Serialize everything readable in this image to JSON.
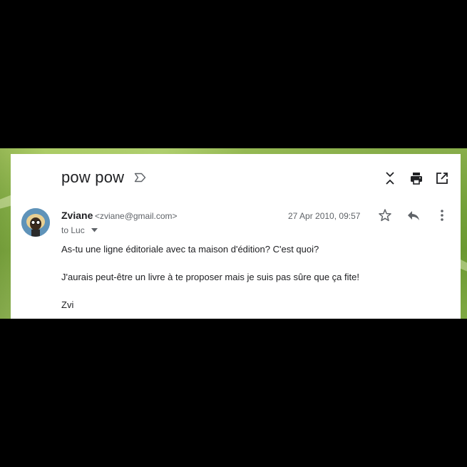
{
  "email": {
    "subject": "pow pow",
    "sender": {
      "name": "Zviane",
      "email": "<zviane@gmail.com>"
    },
    "date": "27 Apr 2010, 09:57",
    "recipient_line": "to Luc",
    "body_lines": [
      "As-tu une ligne éditoriale avec ta maison d'édition? C'est quoi?",
      "J'aurais peut-être un livre à te proposer mais je suis pas sûre que ça fite!",
      "Zvi"
    ]
  },
  "icons": {
    "label": "label-icon",
    "collapse": "collapse-all-icon",
    "print": "print-icon",
    "open_new": "open-in-new-window-icon",
    "star": "star-icon",
    "reply": "reply-icon",
    "more": "more-vert-icon",
    "caret": "caret-down-icon"
  },
  "colors": {
    "text_primary": "#202124",
    "text_secondary": "#5f6368",
    "icon": "#5f6368",
    "card_bg": "#ffffff",
    "letterbox": "#000000"
  }
}
